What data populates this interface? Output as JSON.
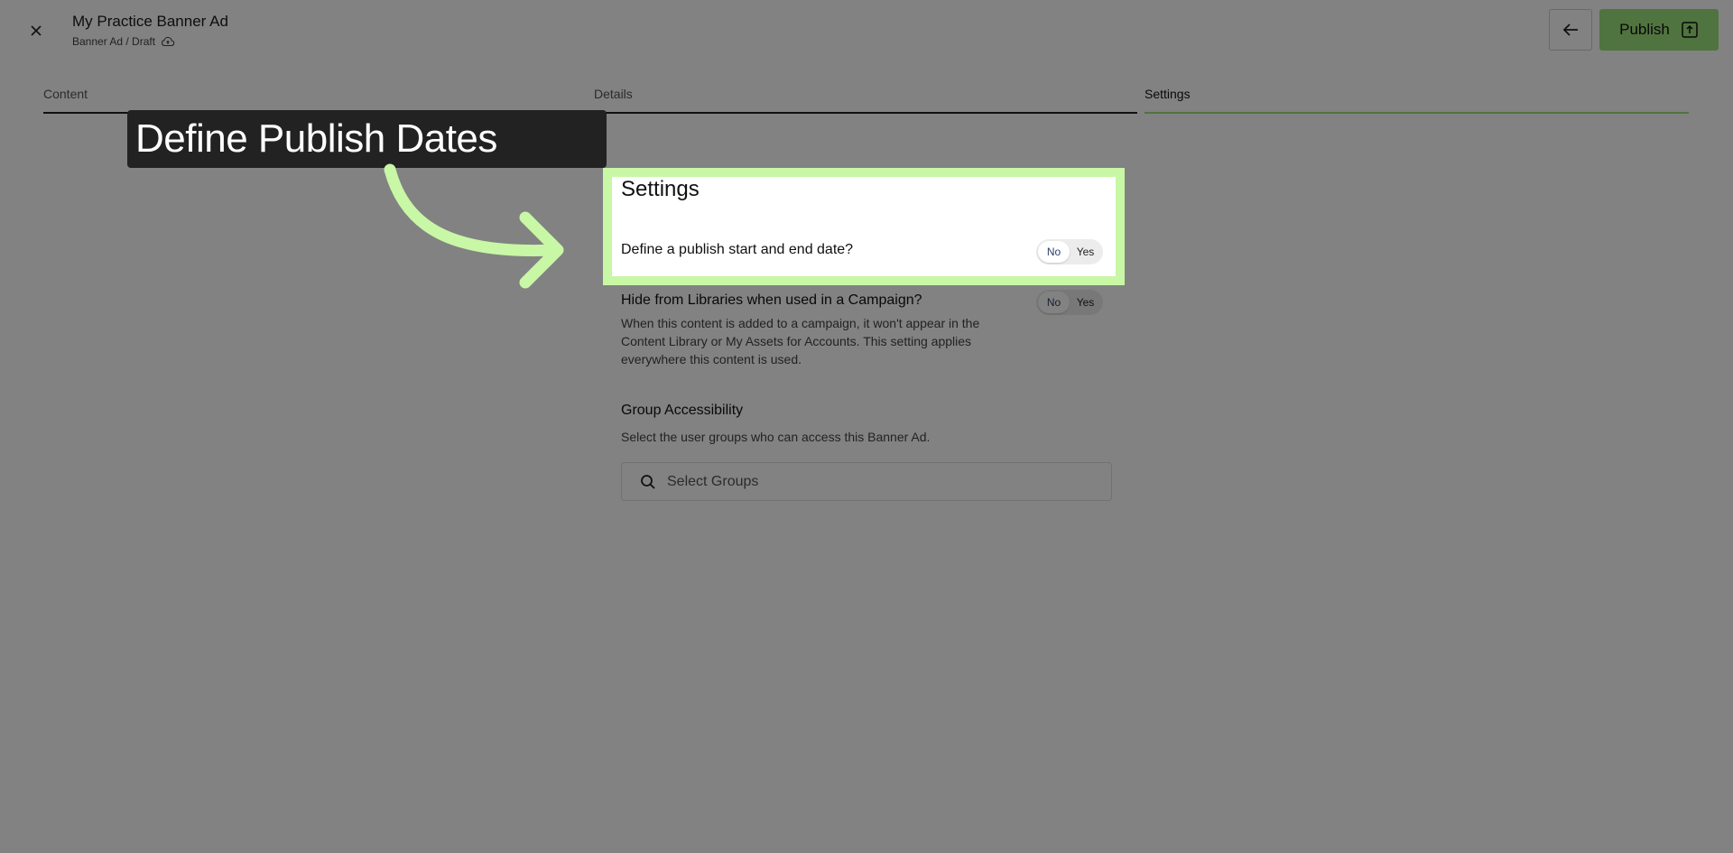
{
  "header": {
    "title": "My Practice Banner Ad",
    "subtitle": "Banner Ad / Draft",
    "publish_label": "Publish"
  },
  "tabs": [
    {
      "label": "Content",
      "active": false
    },
    {
      "label": "Details",
      "active": false
    },
    {
      "label": "Settings",
      "active": true
    }
  ],
  "settings": {
    "title": "Settings",
    "publish_dates": {
      "label": "Define a publish start and end date?",
      "options": [
        "No",
        "Yes"
      ],
      "selected": "No"
    },
    "hide_libraries": {
      "label": "Hide from Libraries when used in a Campaign?",
      "description": "When this content is added to a campaign, it won't appear in the Content Library or My Assets for Accounts. This setting applies everywhere this content is used.",
      "options": [
        "No",
        "Yes"
      ],
      "selected": "No"
    },
    "group_accessibility": {
      "title": "Group Accessibility",
      "description": "Select the user groups who can access this Banner Ad.",
      "placeholder": "Select Groups"
    }
  },
  "callout": {
    "text": "Define Publish Dates"
  },
  "colors": {
    "accent": "#9ee37d",
    "highlight": "#c8f7a6",
    "callout_bg": "#222222"
  },
  "icons": [
    "close-icon",
    "cloud-upload-icon",
    "arrow-left-icon",
    "publish-icon",
    "search-icon",
    "curved-arrow-icon"
  ]
}
